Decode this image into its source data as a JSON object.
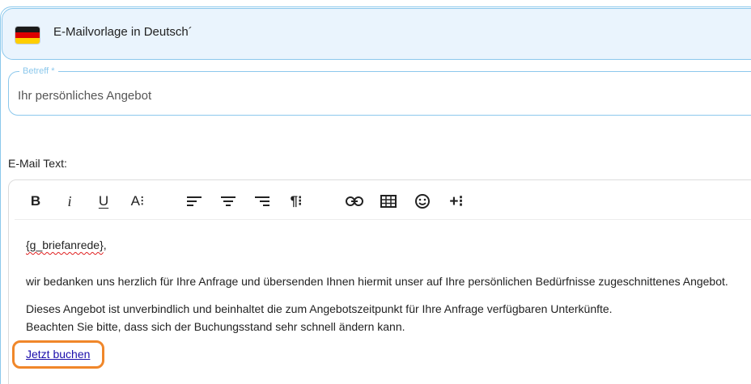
{
  "header": {
    "title": "E-Mailvorlage in Deutsch´",
    "flag_icon": "german-flag-icon"
  },
  "subject": {
    "label": "Betreff *",
    "value": "Ihr persönliches Angebot"
  },
  "email_text": {
    "label": "E-Mail Text:"
  },
  "toolbar": {
    "bold": "B",
    "italic": "i",
    "underline": "U",
    "font_size": "A⁝",
    "paragraph": "¶⁝",
    "insert_more": "+⁝"
  },
  "body": {
    "salutation_variable": "{g_briefanrede}",
    "salutation_suffix": ",",
    "paragraph1": "wir bedanken uns herzlich für Ihre Anfrage und übersenden Ihnen hiermit unser auf Ihre persönlichen Bedürfnisse zugeschnittenes Angebot.",
    "paragraph2_line1": "Dieses Angebot ist unverbindlich und beinhaltet die zum Angebotszeitpunkt für Ihre Anfrage verfügbaren Unterkünfte.",
    "paragraph2_line2": "Beachten Sie bitte, dass sich der Buchungsstand sehr schnell ändern kann.",
    "link_text": "Jetzt buchen"
  },
  "colors": {
    "accent_border": "#8cc8ec",
    "header_bg": "#eaf4fd",
    "highlight": "#f0872a",
    "link": "#1a0dab"
  }
}
